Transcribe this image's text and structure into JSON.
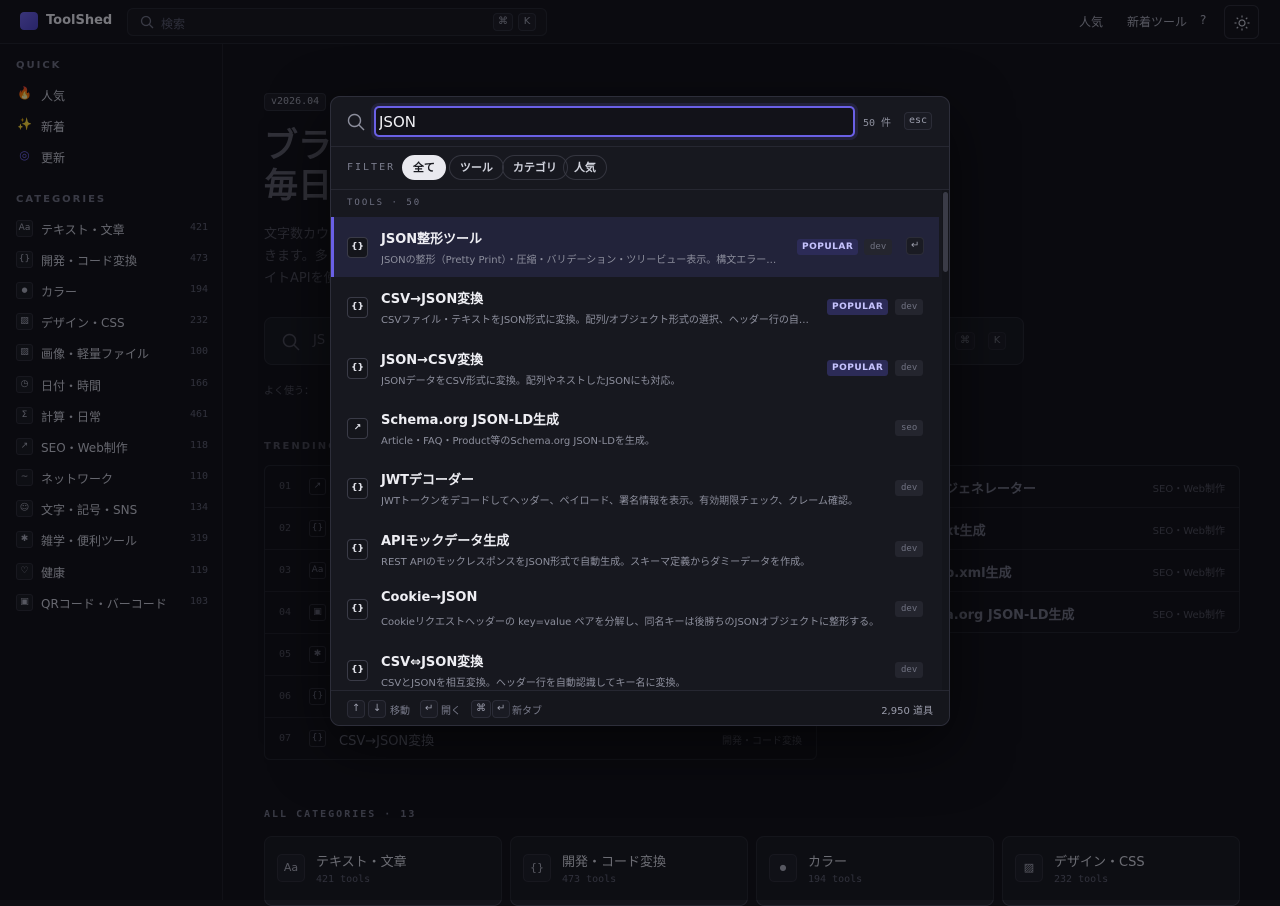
{
  "topbar": {
    "brand": "ToolShed",
    "search_placeholder": "検索",
    "shortcut_mod": "⌘",
    "shortcut_key": "K",
    "nav_popular": "人気",
    "nav_new": "新着ツール",
    "help": "?"
  },
  "sidebar": {
    "quick_heading": "QUICK",
    "quick": [
      {
        "icon": "🔥",
        "label": "人気"
      },
      {
        "icon": "✨",
        "label": "新着"
      },
      {
        "icon": "◎",
        "label": "更新"
      }
    ],
    "categories_heading": "CATEGORIES",
    "categories": [
      {
        "icon": "Aa",
        "label": "テキスト・文章",
        "count": "421"
      },
      {
        "icon": "{}",
        "label": "開発・コード変換",
        "count": "473"
      },
      {
        "icon": "●",
        "label": "カラー",
        "count": "194"
      },
      {
        "icon": "▨",
        "label": "デザイン・CSS",
        "count": "232"
      },
      {
        "icon": "▨",
        "label": "画像・軽量ファイル",
        "count": "100"
      },
      {
        "icon": "◷",
        "label": "日付・時間",
        "count": "166"
      },
      {
        "icon": "Σ",
        "label": "計算・日常",
        "count": "461"
      },
      {
        "icon": "↗",
        "label": "SEO・Web制作",
        "count": "118"
      },
      {
        "icon": "~",
        "label": "ネットワーク",
        "count": "110"
      },
      {
        "icon": "☺",
        "label": "文字・記号・SNS",
        "count": "134"
      },
      {
        "icon": "✱",
        "label": "雑学・便利ツール",
        "count": "319"
      },
      {
        "icon": "♡",
        "label": "健康",
        "count": "119"
      },
      {
        "icon": "▣",
        "label": "QRコード・バーコード",
        "count": "103"
      }
    ]
  },
  "hero": {
    "version": "v2026.04",
    "title": "ブラウ\n毎日",
    "desc": "文字数カウ\nきます。多く\nイトAPIを使",
    "search_placeholder": "JS",
    "frequent_label": "よく使う："
  },
  "trending": {
    "heading": "TRENDING",
    "rows": [
      {
        "num": "01",
        "icon": "↗",
        "name": "",
        "cat": ""
      },
      {
        "num": "02",
        "icon": "{}",
        "name": "",
        "cat": ""
      },
      {
        "num": "03",
        "icon": "Aa",
        "name": "",
        "cat": ""
      },
      {
        "num": "04",
        "icon": "▣",
        "name": "",
        "cat": ""
      },
      {
        "num": "05",
        "icon": "✱",
        "name": "",
        "cat": ""
      },
      {
        "num": "06",
        "icon": "{}",
        "name": "",
        "cat": ""
      },
      {
        "num": "07",
        "icon": "{}",
        "name": "CSV→JSON変換",
        "cat": "開発・コード変換"
      }
    ]
  },
  "right_list": [
    {
      "name": "ジェネレーター",
      "cat": "SEO・Web制作"
    },
    {
      "name": "xt生成",
      "cat": "SEO・Web制作"
    },
    {
      "name": "p.xml生成",
      "cat": "SEO・Web制作"
    },
    {
      "name": "a.org JSON-LD生成",
      "cat": "SEO・Web制作"
    }
  ],
  "all_categories": {
    "heading": "ALL CATEGORIES · 13",
    "cards": [
      {
        "icon": "Aa",
        "name": "テキスト・文章",
        "count": "421 tools"
      },
      {
        "icon": "{}",
        "name": "開発・コード変換",
        "count": "473 tools"
      },
      {
        "icon": "●",
        "name": "カラー",
        "count": "194 tools"
      },
      {
        "icon": "▨",
        "name": "デザイン・CSS",
        "count": "232 tools"
      }
    ]
  },
  "modal": {
    "query": "JSON",
    "result_count": "50 件",
    "esc": "esc",
    "filter_label": "FILTER",
    "filters": [
      "全て",
      "ツール",
      "カテゴリ",
      "人気"
    ],
    "tools_heading": "TOOLS · 50",
    "results": [
      {
        "icon": "{}",
        "name": "JSON整形ツール",
        "desc": "JSONの整形（Pretty Print）・圧縮・バリデーション・ツリービュー表示。構文エラーの位置表示。",
        "popular": "POPULAR",
        "tag": "dev"
      },
      {
        "icon": "{}",
        "name": "CSV→JSON変換",
        "desc": "CSVファイル・テキストをJSON形式に変換。配列/オブジェクト形式の選択、ヘッダー行の自動認識。",
        "popular": "POPULAR",
        "tag": "dev"
      },
      {
        "icon": "{}",
        "name": "JSON→CSV変換",
        "desc": "JSONデータをCSV形式に変換。配列やネストしたJSONにも対応。",
        "popular": "POPULAR",
        "tag": "dev"
      },
      {
        "icon": "↗",
        "name": "Schema.org JSON-LD生成",
        "desc": "Article・FAQ・Product等のSchema.org JSON-LDを生成。",
        "popular": "",
        "tag": "seo"
      },
      {
        "icon": "{}",
        "name": "JWTデコーダー",
        "desc": "JWTトークンをデコードしてヘッダー、ペイロード、署名情報を表示。有効期限チェック、クレーム確認。",
        "popular": "",
        "tag": "dev"
      },
      {
        "icon": "{}",
        "name": "APIモックデータ生成",
        "desc": "REST APIのモックレスポンスをJSON形式で自動生成。スキーマ定義からダミーデータを作成。",
        "popular": "",
        "tag": "dev"
      },
      {
        "icon": "{}",
        "name": "Cookie→JSON",
        "desc": "Cookieリクエストヘッダーの key=value ペアを分解し、同名キーは後勝ちのJSONオブジェクトに整形する。",
        "popular": "",
        "tag": "dev"
      },
      {
        "icon": "{}",
        "name": "CSV⇔JSON変換",
        "desc": "CSVとJSONを相互変換。ヘッダー行を自動認識してキー名に変換。",
        "popular": "",
        "tag": "dev"
      }
    ],
    "enter_key": "↵",
    "footer": {
      "up": "↑",
      "down": "↓",
      "move": "移動",
      "enter": "↵",
      "open": "開く",
      "cmd": "⌘",
      "enter2": "↵",
      "newtab": "新タブ",
      "total": "2,950 道具"
    }
  },
  "colors": {
    "accent": "#6a60e6",
    "background": "#0f0f14",
    "popular_badge": "#2c2b57"
  }
}
